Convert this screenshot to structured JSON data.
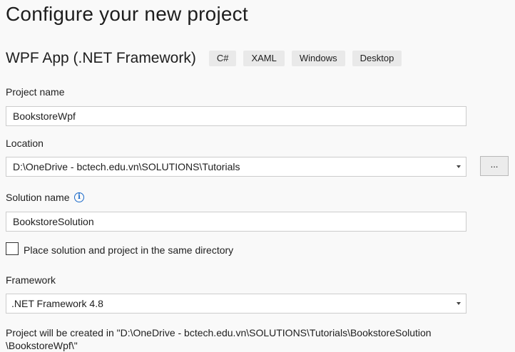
{
  "page_title": "Configure your new project",
  "template": {
    "name": "WPF App (.NET Framework)",
    "tags": [
      "C#",
      "XAML",
      "Windows",
      "Desktop"
    ]
  },
  "project_name": {
    "label": "Project name",
    "value": "BookstoreWpf"
  },
  "location": {
    "label": "Location",
    "value": "D:\\OneDrive - bctech.edu.vn\\SOLUTIONS\\Tutorials",
    "browse_label": "..."
  },
  "solution_name": {
    "label": "Solution name",
    "info_icon": "i",
    "value": "BookstoreSolution"
  },
  "same_directory": {
    "label": "Place solution and project in the same directory",
    "checked": false
  },
  "framework": {
    "label": "Framework",
    "value": ".NET Framework 4.8"
  },
  "summary": {
    "line1": "Project will be created in \"D:\\OneDrive - bctech.edu.vn\\SOLUTIONS\\Tutorials\\BookstoreSolution",
    "line2": "\\BookstoreWpf\\\""
  }
}
